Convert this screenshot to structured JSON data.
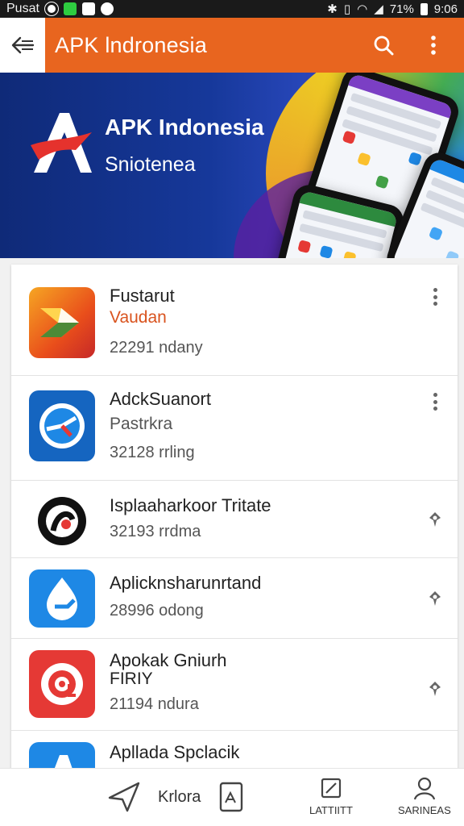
{
  "status_bar": {
    "carrier": "Pusat",
    "battery": "71%",
    "time": "9:06"
  },
  "app_bar": {
    "title": "APK lndronesia"
  },
  "banner": {
    "title": "APK Indonesia",
    "subtitle": "Sniotenea"
  },
  "apps": [
    {
      "name": "Fustarut",
      "sub": "Vaudan",
      "sub_color": "#d9531e",
      "count": "22291 ndany",
      "action": "more"
    },
    {
      "name": "AdckSuanort",
      "sub": "Pastrkra",
      "sub_color": "#555555",
      "count": "32128 rrling",
      "action": "more"
    },
    {
      "name": "Isplaaharkoor Tritate",
      "sub": "",
      "sub_color": "#555555",
      "count": "32193 rrdma",
      "action": "pin"
    },
    {
      "name": "Aplicknsharunrtand",
      "sub": "",
      "sub_color": "#555555",
      "count": "28996 odong",
      "action": "pin"
    },
    {
      "name": "Apokak Gniurh",
      "sub": "FIRIY",
      "sub_color": "#222222",
      "count": "21194 ndura",
      "action": "pin"
    },
    {
      "name": "Apllada Spclacik",
      "sub": "",
      "sub_color": "#555555",
      "count": "",
      "action": "none"
    }
  ],
  "bottom_nav": {
    "center_label": "Krlora",
    "item3_label": "LATTIITT",
    "item4_label": "SARINEAS"
  },
  "colors": {
    "app_bar": "#e8651f",
    "banner": "#16389a",
    "accent_text": "#d9531e"
  },
  "icons": {
    "back": "back-arrow-icon",
    "search": "search-icon",
    "overflow": "overflow-menu-icon"
  }
}
